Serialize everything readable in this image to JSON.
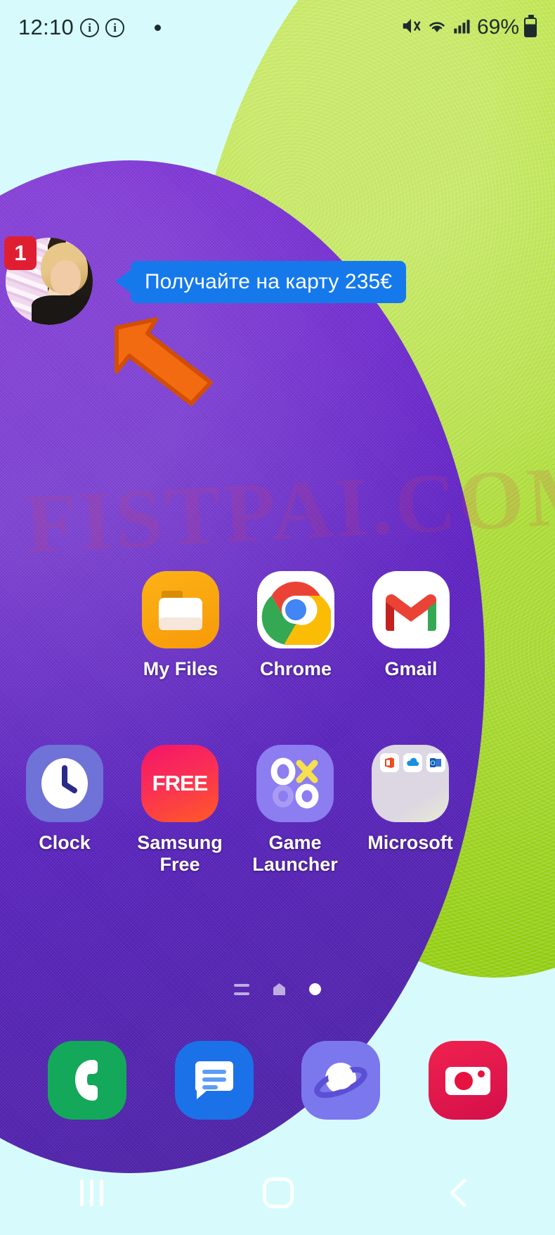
{
  "status_bar": {
    "time": "12:10",
    "info_icon_1": "info-circle-icon",
    "info_icon_2": "info-circle-icon",
    "notification_dot": "notification-dot-icon",
    "mute_icon": "mute-vibrate-icon",
    "wifi_icon": "wifi-icon",
    "signal_icon": "cellular-signal-icon",
    "battery_percent": "69%",
    "battery_icon": "battery-icon"
  },
  "overlay": {
    "chat_head": {
      "badge_count": "1",
      "avatar_name": "chat-head-avatar"
    },
    "bubble": {
      "text": "Получайте на карту 235€",
      "color": "#1579ec",
      "text_color": "#ffffff"
    },
    "arrow": {
      "name": "pointer-arrow-icon",
      "color": "#f06a0f",
      "stroke": "#d24e05"
    }
  },
  "home": {
    "rows": [
      {
        "apps": [
          {
            "label": "My Files",
            "icon": "my-files-icon"
          },
          {
            "label": "Chrome",
            "icon": "chrome-icon"
          },
          {
            "label": "Gmail",
            "icon": "gmail-icon"
          }
        ]
      },
      {
        "apps": [
          {
            "label": "Clock",
            "icon": "clock-icon"
          },
          {
            "label": "Samsung Free",
            "icon": "samsung-free-icon"
          },
          {
            "label": "Game Launcher",
            "icon": "game-launcher-icon"
          },
          {
            "label": "Microsoft",
            "icon": "microsoft-folder-icon"
          }
        ]
      }
    ],
    "samsung_free_text": "FREE",
    "page_indicators": {
      "items": [
        "list-page-icon",
        "home-page-icon",
        "active-page-dot"
      ],
      "active_index": 2
    },
    "dock": [
      {
        "label": "Phone",
        "icon": "phone-icon"
      },
      {
        "label": "Messages",
        "icon": "messages-icon"
      },
      {
        "label": "Samsung Internet",
        "icon": "internet-icon"
      },
      {
        "label": "Camera",
        "icon": "camera-icon"
      }
    ]
  },
  "nav_bar": {
    "recents": "recents-icon",
    "home": "home-icon",
    "back": "back-icon"
  },
  "wallpaper": {
    "watermark": "FISTPAI.COM",
    "green": "#a9db1c",
    "purple": "#6a22cf",
    "sky": "#d7fbfd"
  }
}
